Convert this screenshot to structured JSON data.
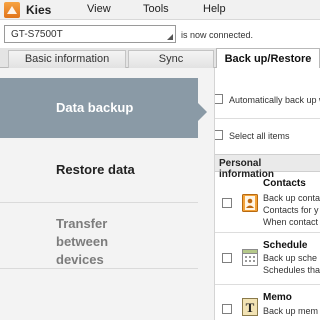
{
  "app": {
    "name": "Kies"
  },
  "menu": {
    "items": [
      "View",
      "Tools",
      "Help"
    ]
  },
  "device": {
    "selected": "GT-S7500T",
    "status": "is now connected."
  },
  "tabs": [
    "Basic information",
    "Sync",
    "Back up/Restore"
  ],
  "sidebar": {
    "items": [
      {
        "label": "Data backup",
        "state": "active"
      },
      {
        "label": "Restore data",
        "state": "normal"
      },
      {
        "label": "Transfer between devices",
        "state": "disabled"
      }
    ]
  },
  "content": {
    "auto_backup_label": "Automatically back up w",
    "select_all_label": "Select all items",
    "section_title": "Personal information",
    "items": [
      {
        "title": "Contacts",
        "desc1": "Back up conta",
        "desc2": "Contacts for y",
        "desc3": "When contact",
        "icon": "contacts-icon"
      },
      {
        "title": "Schedule",
        "desc1": "Back up sche",
        "desc2": "Schedules tha",
        "icon": "calendar-icon"
      },
      {
        "title": "Memo",
        "desc1": "Back up mem",
        "icon": "memo-icon"
      }
    ]
  },
  "colors": {
    "nav_active": "#8a9aa6",
    "logo": "#f08a2b"
  }
}
